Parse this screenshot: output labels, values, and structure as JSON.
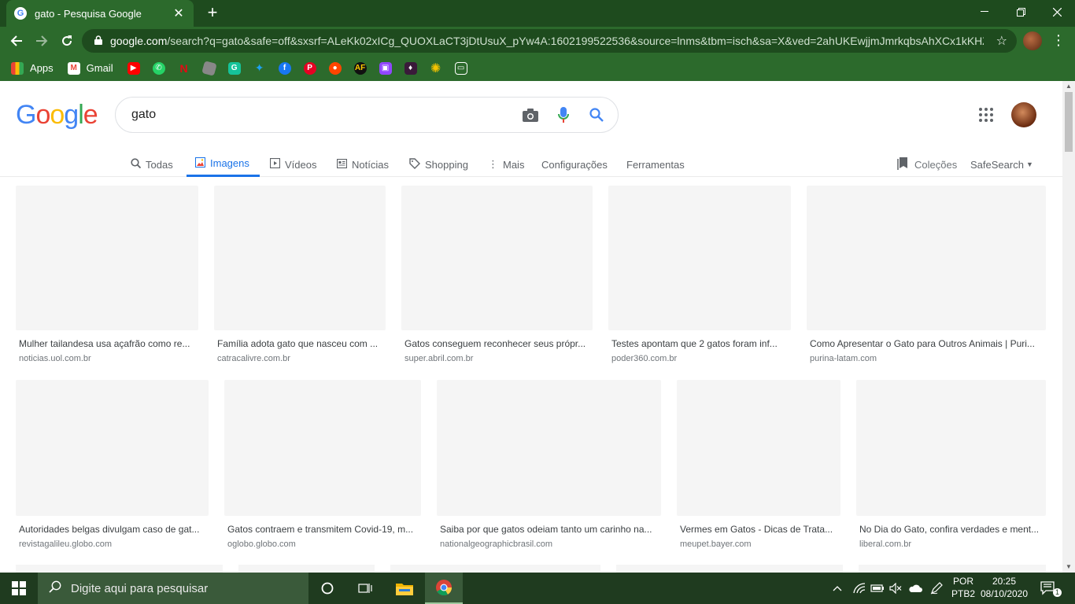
{
  "browser": {
    "tab_title": "gato - Pesquisa Google",
    "tab_close": "✕",
    "new_tab": "+",
    "url_domain": "google.com",
    "url_path": "/search?q=gato&safe=off&sxsrf=ALeKk02xICg_QUOXLaCT3jDtUsuX_pYw4A:1602199522536&source=lnms&tbm=isch&sa=X&ved=2ahUKEwjjmJmrkqbsAhXCx1kKHZ..."
  },
  "bookmarks": {
    "apps": "Apps",
    "gmail": "Gmail"
  },
  "search": {
    "query": "gato"
  },
  "nav": {
    "todas": "Todas",
    "imagens": "Imagens",
    "videos": "Vídeos",
    "noticias": "Notícias",
    "shopping": "Shopping",
    "mais": "Mais",
    "configuracoes": "Configurações",
    "ferramentas": "Ferramentas",
    "colecoes": "Coleções",
    "safesearch": "SafeSearch"
  },
  "results": [
    {
      "caption": "Mulher tailandesa usa açafrão como re...",
      "source": "noticias.uol.com.br"
    },
    {
      "caption": "Família adota gato que nasceu com ...",
      "source": "catracalivre.com.br"
    },
    {
      "caption": "Gatos conseguem reconhecer seus própr...",
      "source": "super.abril.com.br"
    },
    {
      "caption": "Testes apontam que 2 gatos foram inf...",
      "source": "poder360.com.br"
    },
    {
      "caption": "Como Apresentar o Gato para Outros Animais | Puri...",
      "source": "purina-latam.com"
    },
    {
      "caption": "Autoridades belgas divulgam caso de gat...",
      "source": "revistagalileu.globo.com"
    },
    {
      "caption": "Gatos contraem e transmitem Covid-19, m...",
      "source": "oglobo.globo.com"
    },
    {
      "caption": "Saiba por que gatos odeiam tanto um carinho na...",
      "source": "nationalgeographicbrasil.com"
    },
    {
      "caption": "Vermes em Gatos - Dicas de Trata...",
      "source": "meupet.bayer.com"
    },
    {
      "caption": "No Dia do Gato, confira verdades e ment...",
      "source": "liberal.com.br"
    }
  ],
  "taskbar": {
    "search_placeholder": "Digite aqui para pesquisar",
    "lang_top": "POR",
    "lang_bottom": "PTB2",
    "time": "20:25",
    "date": "08/10/2020",
    "notification_count": "1"
  },
  "colors": {
    "chrome_dark": "#1e4b1e",
    "chrome": "#2c6a2c",
    "google_blue": "#1a73e8"
  }
}
